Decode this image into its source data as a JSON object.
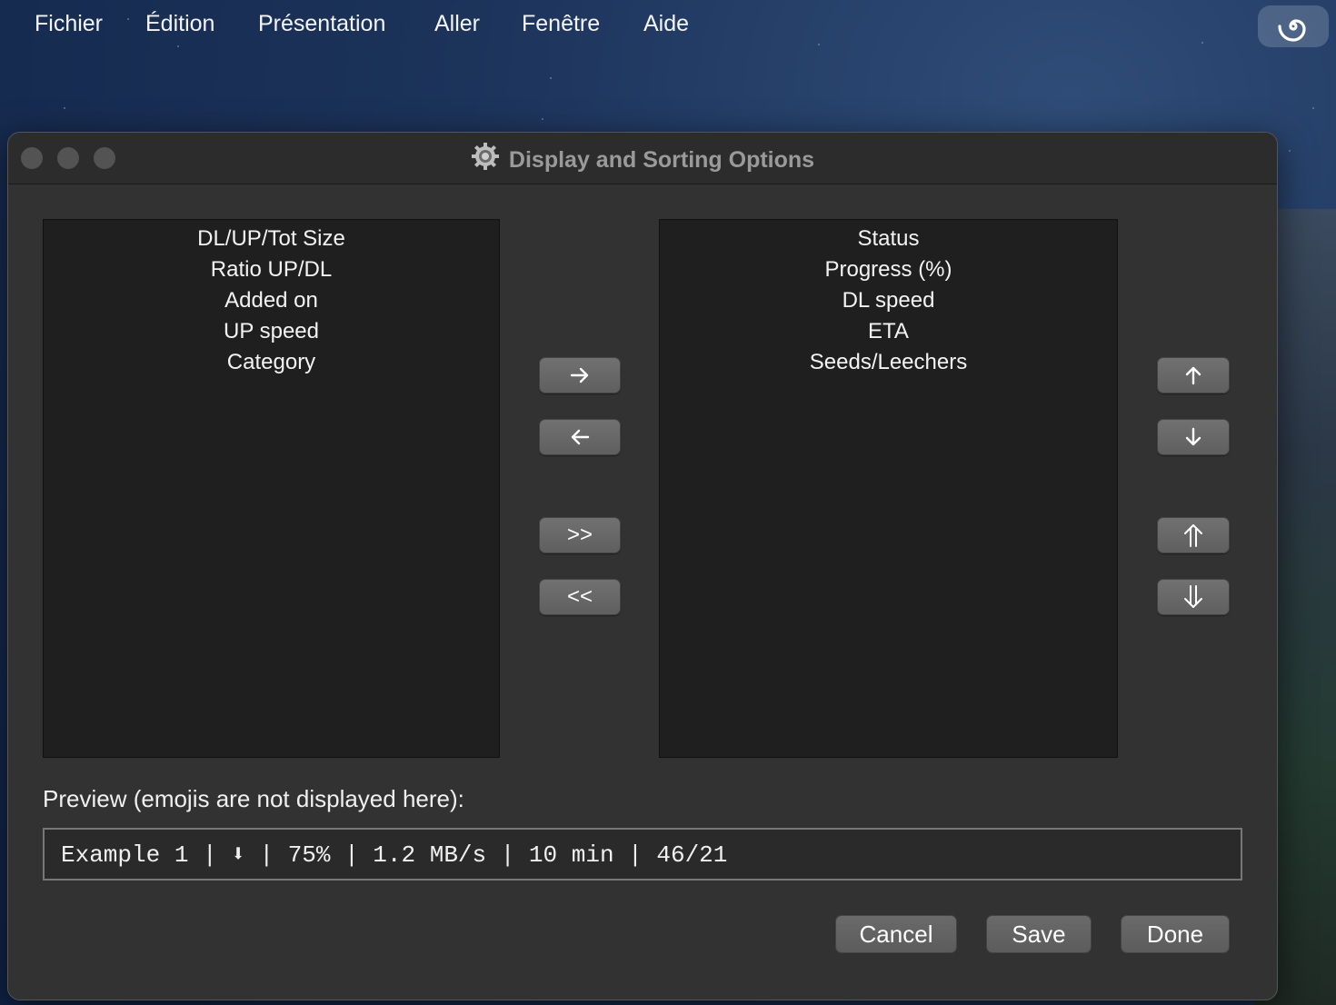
{
  "menubar": {
    "items": [
      "Fichier",
      "Édition",
      "Présentation",
      "Aller",
      "Fenêtre",
      "Aide"
    ],
    "status_icon": "spiral-icon"
  },
  "window": {
    "title": "Display and Sorting Options",
    "title_icon": "gear-icon"
  },
  "available_columns": [
    "DL/UP/Tot Size",
    "Ratio UP/DL",
    "Added on",
    "UP speed",
    "Category"
  ],
  "displayed_columns": [
    "Status",
    "Progress (%)",
    "DL speed",
    "ETA",
    "Seeds/Leechers"
  ],
  "transfer_buttons": {
    "add_all": ">>",
    "remove_all": "<<"
  },
  "preview": {
    "label": "Preview (emojis are not displayed here):",
    "text": "Example 1 | ⬇ | 75% | 1.2 MB/s | 10 min | 46/21"
  },
  "dialog_buttons": {
    "cancel": "Cancel",
    "save": "Save",
    "done": "Done"
  }
}
